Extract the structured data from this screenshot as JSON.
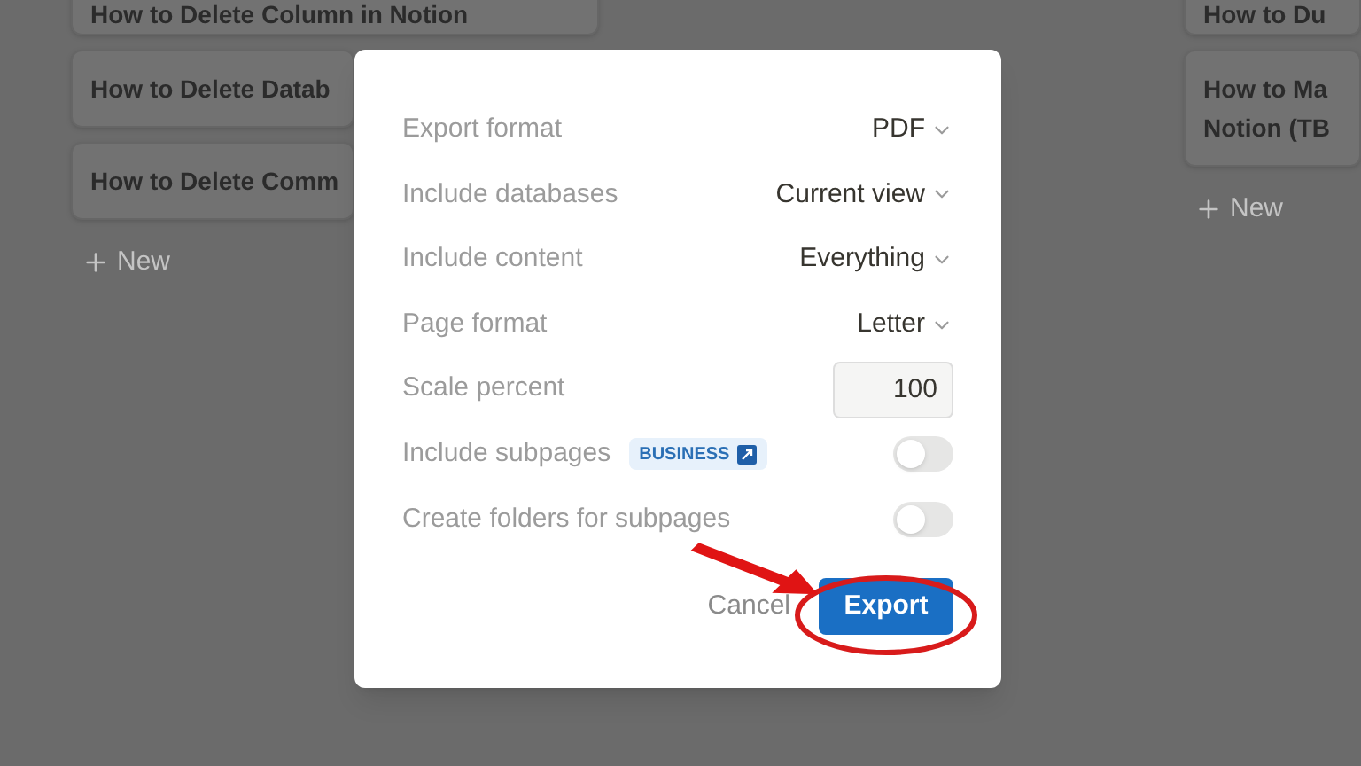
{
  "board": {
    "left_column": {
      "cards": [
        {
          "lines": [
            "How to Delete Column in Notion"
          ]
        },
        {
          "lines": [
            "How to Delete Datab"
          ]
        },
        {
          "lines": [
            "How to Delete Comm"
          ]
        }
      ],
      "new_label": "New"
    },
    "right_column": {
      "cards": [
        {
          "lines": [
            "How to Du"
          ]
        },
        {
          "lines": [
            "How to Ma",
            "Notion (TB"
          ]
        }
      ],
      "new_label": "New"
    }
  },
  "export_dialog": {
    "rows": [
      {
        "kind": "dropdown",
        "label": "Export format",
        "value": "PDF"
      },
      {
        "kind": "dropdown",
        "label": "Include databases",
        "value": "Current view"
      },
      {
        "kind": "dropdown",
        "label": "Include content",
        "value": "Everything"
      },
      {
        "kind": "dropdown",
        "label": "Page format",
        "value": "Letter"
      },
      {
        "kind": "number",
        "label": "Scale percent",
        "value": "100"
      },
      {
        "kind": "toggle",
        "label": "Include subpages",
        "badge": "BUSINESS",
        "on": false
      },
      {
        "kind": "toggle",
        "label": "Create folders for subpages",
        "on": false
      }
    ],
    "cancel": "Cancel",
    "export": "Export"
  }
}
